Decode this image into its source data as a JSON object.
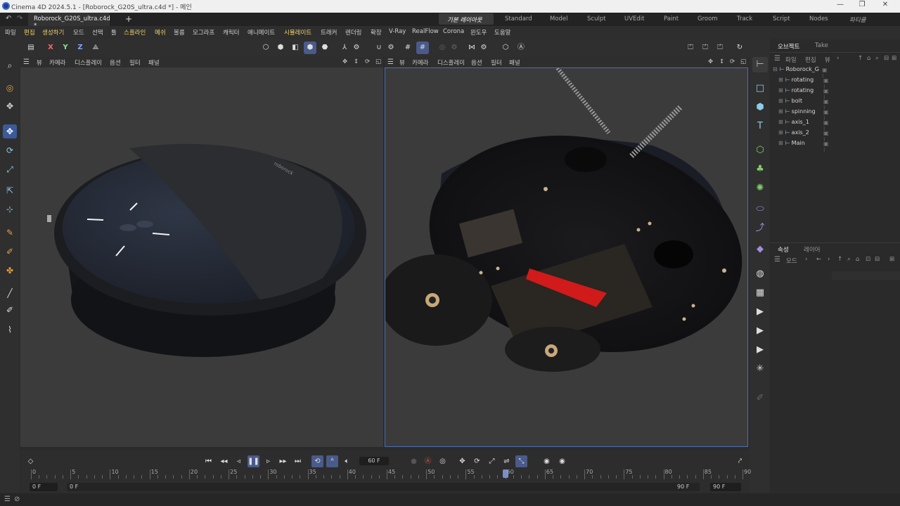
{
  "window": {
    "title": "Cinema 4D 2024.5.1 - [Roborock_G20S_ultra.c4d *] - 메인",
    "minimize": "—",
    "maximize": "❐",
    "close": "✕"
  },
  "tabs": {
    "document": "Roborock_G20S_ultra.c4d *",
    "add": "+",
    "layouts": [
      "기본 레이아웃",
      "Standard",
      "Model",
      "Sculpt",
      "UVEdit",
      "Paint",
      "Groom",
      "Track",
      "Script",
      "Nodes",
      "파티클"
    ]
  },
  "menu": [
    "파일",
    "편집",
    "생성하기",
    "모드",
    "선택",
    "툴",
    "스플라인",
    "메쉬",
    "볼륨",
    "모그라프",
    "캐릭터",
    "애니메이트",
    "시뮬레이트",
    "트래커",
    "렌더링",
    "확장",
    "V-Ray",
    "RealFlow",
    "Corona",
    "윈도우",
    "도움말"
  ],
  "toolbar": {
    "x": "X",
    "y": "Y",
    "z": "Z"
  },
  "viewport_menu": [
    "뷰",
    "카메라",
    "디스플레이",
    "옵션",
    "필터",
    "패널"
  ],
  "object_panel": {
    "tabs": [
      "오브젝트",
      "Take"
    ],
    "menu": [
      "파일",
      "편집",
      "뷰"
    ],
    "items": [
      "Roborock_G",
      "rotating",
      "rotating",
      "bolt",
      "spinning",
      "axis_1",
      "axis_2",
      "Main"
    ]
  },
  "attr_panel": {
    "tabs": [
      "속성",
      "레이어"
    ],
    "mode": "모드"
  },
  "timeline": {
    "current_frame": "60 F",
    "start_a": "0 F",
    "start_b": "0 F",
    "end_a": "90 F",
    "end_b": "90 F",
    "ticks": [
      "0",
      "5",
      "10",
      "15",
      "20",
      "25",
      "30",
      "35",
      "40",
      "45",
      "50",
      "55",
      "60",
      "65",
      "70",
      "75",
      "80",
      "85",
      "90"
    ],
    "playhead_frame": 60,
    "max_frame": 90
  },
  "brand_text": "roborock",
  "colors": {
    "accent": "#4a6fb5",
    "menu_highlight": "#f2d46c",
    "brush_red": "#d11a1a"
  }
}
